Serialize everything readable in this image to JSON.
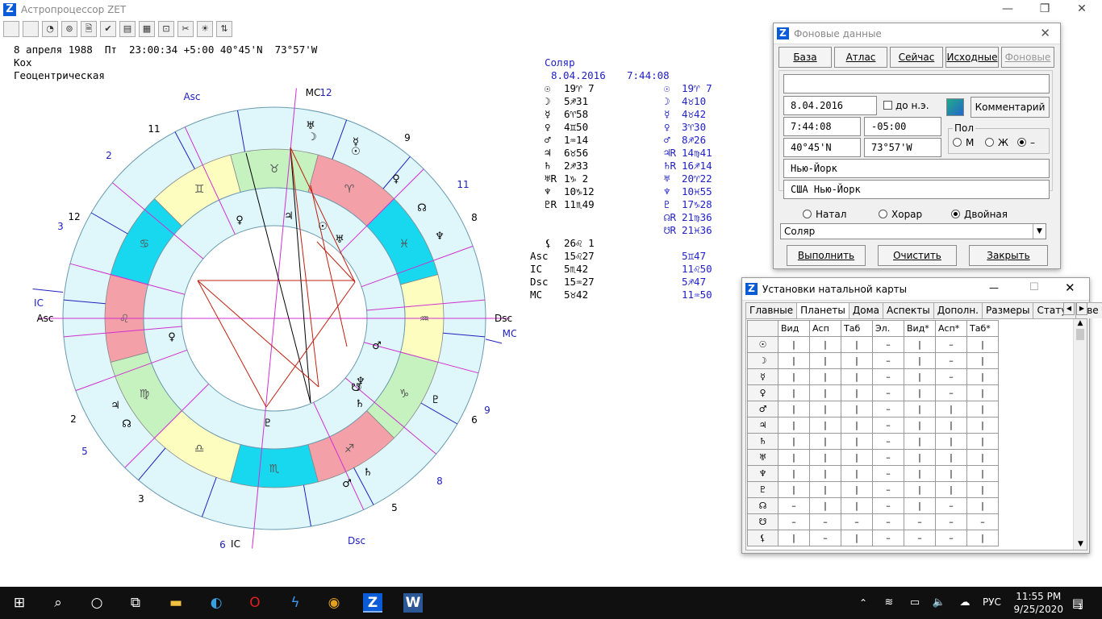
{
  "window": {
    "title": "Астропроцессор ZET",
    "logo": "Z",
    "minimize": "—",
    "maximize": "❐",
    "close": "✕"
  },
  "toolbar": [
    "",
    "",
    "◔",
    "⊚",
    "🗎",
    "✔",
    "▤",
    "▦",
    "⊡",
    "✂",
    "☀",
    "⇅"
  ],
  "header": {
    "line1": "8 апреля 1988  Пт  23:00:34 +5:00 40°45'N  73°57'W",
    "line2": "Кох",
    "line3": "Геоцентрическая"
  },
  "chart_labels": {
    "asc_top": "Asc",
    "mc_top": "MC",
    "mc_top_num": "12",
    "ic_left": "IC",
    "asc_left": "Asc",
    "dsc_right": "Dsc",
    "mc_right": "MC",
    "ic_bottom": "IC",
    "ic_bottom_num": "6",
    "dsc_bottom": "Dsc"
  },
  "house_numbers_black": [
    "11",
    "9",
    "12",
    "8",
    "2",
    "6",
    "3",
    "5"
  ],
  "house_numbers_blue": [
    "2",
    "11",
    "3",
    "9",
    "5",
    "8"
  ],
  "zodiac": [
    "♉",
    "♈",
    "♓",
    "♒",
    "♑",
    "♐",
    "♏",
    "♎",
    "♍",
    "♌",
    "♋",
    "♊"
  ],
  "inner_planets": [
    "♀",
    "♃",
    "☉",
    "♅",
    "♂",
    "☋",
    "♆",
    "☽",
    "♄",
    "♇"
  ],
  "outer_planets": [
    "♅",
    "☽",
    "☿",
    "☉",
    "♀",
    "☊",
    "♆",
    "♇",
    "♄",
    "♂",
    "♃",
    "☊"
  ],
  "natal_table": [
    {
      "glyph": "☉",
      "value": "19♈ 7"
    },
    {
      "glyph": "☽",
      "value": "5♐31"
    },
    {
      "glyph": "☿",
      "value": "6♈58"
    },
    {
      "glyph": "♀",
      "value": "4♊50"
    },
    {
      "glyph": "♂",
      "value": "1♒14"
    },
    {
      "glyph": "♃",
      "value": "6♉56"
    },
    {
      "glyph": "♄",
      "value": "2♐33"
    },
    {
      "glyph": "♅R",
      "value": "1♑ 2"
    },
    {
      "glyph": "♆",
      "value": "10♑12"
    },
    {
      "glyph": "♇R",
      "value": "11♏49"
    }
  ],
  "solar_header": {
    "title": "Соляр",
    "date": "8.04.2016",
    "time": "7:44:08"
  },
  "solar_table": [
    {
      "glyph": "☉",
      "value": "19♈ 7"
    },
    {
      "glyph": "☽",
      "value": "4♉10"
    },
    {
      "glyph": "☿",
      "value": "4♉42"
    },
    {
      "glyph": "♀",
      "value": "3♈30"
    },
    {
      "glyph": "♂",
      "value": "8♐26"
    },
    {
      "glyph": "♃R",
      "value": "14♍41"
    },
    {
      "glyph": "♄R",
      "value": "16♐14"
    },
    {
      "glyph": "♅",
      "value": "20♈22"
    },
    {
      "glyph": "♆",
      "value": "10♓55"
    },
    {
      "glyph": "♇",
      "value": "17♑28"
    },
    {
      "glyph": "☊R",
      "value": "21♍36"
    },
    {
      "glyph": "☋R",
      "value": "21♓36"
    }
  ],
  "angles_natal": [
    {
      "name": "⚸",
      "value": "26♌ 1"
    },
    {
      "name": "Asc",
      "value": "15♌27"
    },
    {
      "name": "IC",
      "value": "5♏42"
    },
    {
      "name": "Dsc",
      "value": "15♒27"
    },
    {
      "name": "MC",
      "value": "5♉42"
    }
  ],
  "angles_solar": [
    "5♊47",
    "11♌50",
    "5♐47",
    "11♒50"
  ],
  "bg_dialog": {
    "title": "Фоновые данные",
    "tabs": [
      "База",
      "Атлас",
      "Сейчас",
      "Исходные",
      "Фоновые"
    ],
    "name_value": "",
    "date": "8.04.2016",
    "bc_label": "до н.э.",
    "comment_btn": "Комментарий",
    "time": "7:44:08",
    "tz": "-05:00",
    "lat": "40°45'N",
    "lon": "73°57'W",
    "sex_label": "Пол",
    "sex_m": "М",
    "sex_f": "Ж",
    "sex_none": "–",
    "city": "Нью-Йорк",
    "country": "США Нью-Йорк",
    "mode_natal": "Натал",
    "mode_horar": "Хорар",
    "mode_double": "Двойная",
    "select_value": "Соляр",
    "run": "Выполнить",
    "clear": "Очистить",
    "close": "Закрыть"
  },
  "settings_dialog": {
    "title": "Установки натальной карты",
    "minimize": "—",
    "maximize": "☐",
    "close": "✕",
    "tabs": [
      "Главные",
      "Планеты",
      "Дома",
      "Аспекты",
      "Дополн.",
      "Размеры",
      "Статус",
      "Цве"
    ],
    "columns": [
      "Вид",
      "Асп",
      "Таб",
      "Эл.",
      "Вид*",
      "Асп*",
      "Таб*"
    ],
    "rows": [
      {
        "glyph": "☉",
        "cells": [
          "|",
          "|",
          "|",
          "–",
          "|",
          "–",
          "|"
        ]
      },
      {
        "glyph": "☽",
        "cells": [
          "|",
          "|",
          "|",
          "–",
          "|",
          "–",
          "|"
        ]
      },
      {
        "glyph": "☿",
        "cells": [
          "|",
          "|",
          "|",
          "–",
          "|",
          "–",
          "|"
        ]
      },
      {
        "glyph": "♀",
        "cells": [
          "|",
          "|",
          "|",
          "–",
          "|",
          "–",
          "|"
        ]
      },
      {
        "glyph": "♂",
        "cells": [
          "|",
          "|",
          "|",
          "–",
          "|",
          "|",
          "|"
        ]
      },
      {
        "glyph": "♃",
        "cells": [
          "|",
          "|",
          "|",
          "–",
          "|",
          "|",
          "|"
        ]
      },
      {
        "glyph": "♄",
        "cells": [
          "|",
          "|",
          "|",
          "–",
          "|",
          "|",
          "|"
        ]
      },
      {
        "glyph": "♅",
        "cells": [
          "|",
          "|",
          "|",
          "–",
          "|",
          "|",
          "|"
        ]
      },
      {
        "glyph": "♆",
        "cells": [
          "|",
          "|",
          "|",
          "–",
          "|",
          "|",
          "|"
        ]
      },
      {
        "glyph": "♇",
        "cells": [
          "|",
          "|",
          "|",
          "–",
          "|",
          "|",
          "|"
        ]
      },
      {
        "glyph": "☊",
        "cells": [
          "–",
          "|",
          "|",
          "–",
          "|",
          "–",
          "|"
        ]
      },
      {
        "glyph": "☋",
        "cells": [
          "–",
          "–",
          "–",
          "–",
          "–",
          "–",
          "–"
        ]
      },
      {
        "glyph": "⚸",
        "cells": [
          "|",
          "–",
          "|",
          "–",
          "–",
          "–",
          "|"
        ]
      }
    ]
  },
  "taskbar": {
    "time": "11:55 PM",
    "date": "9/25/2020",
    "lang": "РУС",
    "notif": "1"
  }
}
